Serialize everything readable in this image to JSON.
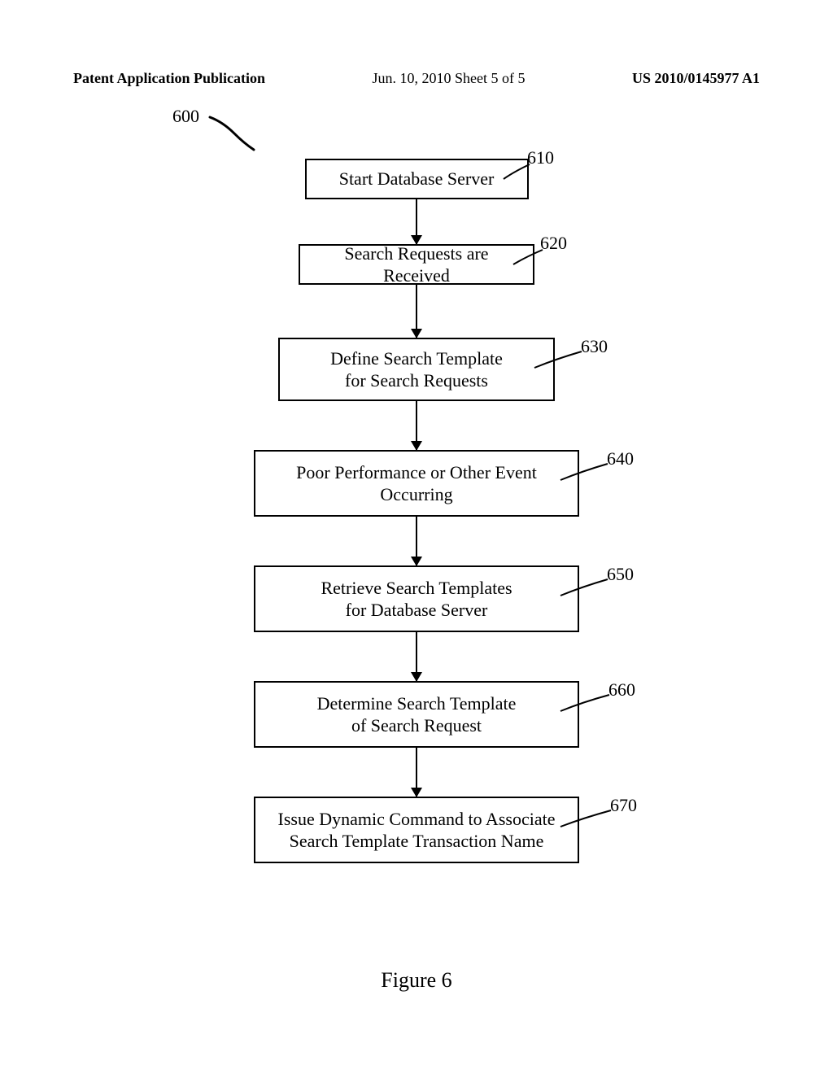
{
  "header": {
    "left": "Patent Application Publication",
    "mid": "Jun. 10, 2010  Sheet 5 of 5",
    "right": "US 2010/0145977 A1"
  },
  "figure_ref": "600",
  "steps": [
    {
      "ref": "610",
      "line1": "Start Database Server",
      "line2": ""
    },
    {
      "ref": "620",
      "line1": "Search Requests are Received",
      "line2": ""
    },
    {
      "ref": "630",
      "line1": "Define Search Template",
      "line2": "for Search  Requests"
    },
    {
      "ref": "640",
      "line1": "Poor Performance or Other Event",
      "line2": "Occurring"
    },
    {
      "ref": "650",
      "line1": "Retrieve Search Templates",
      "line2": "for Database Server"
    },
    {
      "ref": "660",
      "line1": "Determine Search Template",
      "line2": "of Search  Request"
    },
    {
      "ref": "670",
      "line1": "Issue Dynamic Command to Associate",
      "line2": "Search Template Transaction Name"
    }
  ],
  "caption": "Figure 6",
  "chart_data": {
    "type": "flowchart",
    "title": "Figure 6",
    "figure_number": "600",
    "nodes": [
      {
        "id": "610",
        "label": "Start Database Server"
      },
      {
        "id": "620",
        "label": "Search Requests are Received"
      },
      {
        "id": "630",
        "label": "Define Search Template for Search Requests"
      },
      {
        "id": "640",
        "label": "Poor Performance or Other Event Occurring"
      },
      {
        "id": "650",
        "label": "Retrieve Search Templates for Database Server"
      },
      {
        "id": "660",
        "label": "Determine Search Template of Search Request"
      },
      {
        "id": "670",
        "label": "Issue Dynamic Command to Associate Search Template Transaction Name"
      }
    ],
    "edges": [
      {
        "from": "610",
        "to": "620"
      },
      {
        "from": "620",
        "to": "630"
      },
      {
        "from": "630",
        "to": "640"
      },
      {
        "from": "640",
        "to": "650"
      },
      {
        "from": "650",
        "to": "660"
      },
      {
        "from": "660",
        "to": "670"
      }
    ]
  }
}
